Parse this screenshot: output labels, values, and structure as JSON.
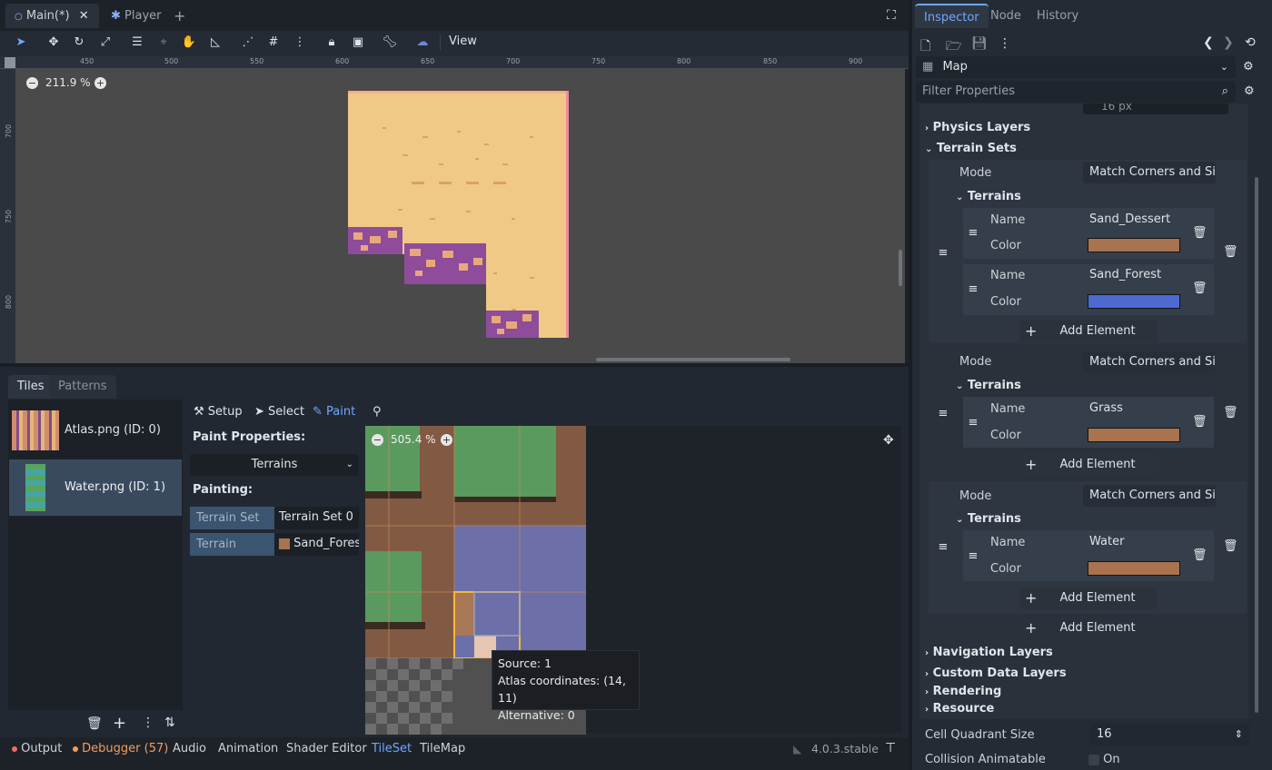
{
  "scene_tabs": [
    {
      "label": "Main(*)",
      "active": true
    },
    {
      "label": "Player",
      "active": false
    }
  ],
  "toolbar": {
    "view_label": "View"
  },
  "ruler": {
    "top_ticks": [
      "450",
      "500",
      "550",
      "600",
      "650",
      "700",
      "750",
      "800",
      "850",
      "900"
    ],
    "left_ticks": [
      "700",
      "750",
      "800"
    ]
  },
  "viewport": {
    "zoom": "211.9 %"
  },
  "bottom_panel": {
    "tabs": [
      "Tiles",
      "Patterns"
    ],
    "sources": [
      {
        "label": "Atlas.png (ID: 0)",
        "selected": false
      },
      {
        "label": "Water.png (ID: 1)",
        "selected": true
      }
    ],
    "modes": {
      "setup": "Setup",
      "select": "Select",
      "paint": "Paint"
    },
    "paint_properties_label": "Paint Properties:",
    "paint_type": "Terrains",
    "painting_label": "Painting:",
    "terrain_set_label": "Terrain Set",
    "terrain_set_value": "Terrain Set 0",
    "terrain_label": "Terrain",
    "terrain_value": "Sand_Forest",
    "atlas_zoom": "505.4 %",
    "tooltip": {
      "source": "Source: 1",
      "coords": "Atlas coordinates: (14, 11)",
      "alternative": "Alternative: 0"
    }
  },
  "status_bar": {
    "output": "Output",
    "debugger": "Debugger (57)",
    "audio": "Audio",
    "animation": "Animation",
    "shader_editor": "Shader Editor",
    "tileset": "TileSet",
    "tilemap": "TileMap",
    "version": "4.0.3.stable"
  },
  "dock_tabs": [
    "Inspector",
    "Node",
    "History"
  ],
  "inspector": {
    "object": "Map",
    "filter_placeholder": "Filter Properties",
    "partial_field": "16 px",
    "physics_layers": "Physics Layers",
    "terrain_sets": "Terrain Sets",
    "mode_label": "Mode",
    "mode_value": "Match Corners and Sides",
    "terrains_label": "Terrains",
    "name_label": "Name",
    "color_label": "Color",
    "add_element": "Add Element",
    "sets": [
      {
        "terrains": [
          {
            "name": "Sand_Dessert",
            "color": "#a8734e"
          },
          {
            "name": "Sand_Forest",
            "color": "#4e69d2"
          }
        ]
      },
      {
        "terrains": [
          {
            "name": "Grass",
            "color": "#a8734e"
          }
        ]
      },
      {
        "terrains": [
          {
            "name": "Water",
            "color": "#a8734e"
          }
        ]
      }
    ],
    "navigation_layers": "Navigation Layers",
    "custom_data_layers": "Custom Data Layers",
    "rendering": "Rendering",
    "resource": "Resource",
    "cell_quadrant_label": "Cell Quadrant Size",
    "cell_quadrant_value": "16",
    "collision_label": "Collision Animatable",
    "collision_value": "On"
  },
  "colors": {
    "accent": "#6fa8ff",
    "sand": "#f1c987",
    "grass": "#5a9a5f",
    "dirt": "#825a43",
    "water": "#6c6fa8",
    "debugger": "#ef9d63"
  }
}
